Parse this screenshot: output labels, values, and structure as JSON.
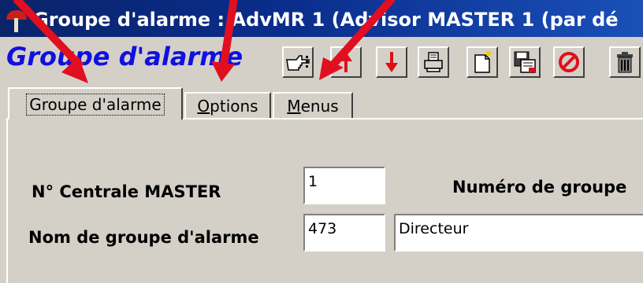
{
  "window": {
    "title": "Groupe d'alarme : AdvMR 1 (Advisor MASTER 1 (par dé",
    "icon": "alarm-light-icon"
  },
  "toolbar": {
    "title": "Groupe d'alarme",
    "buttons": [
      {
        "icon": "pointing-hand-icon"
      },
      {
        "icon": "arrow-up-icon"
      },
      {
        "icon": "arrow-down-icon"
      },
      {
        "icon": "print-icon"
      },
      {
        "icon": "new-document-icon"
      },
      {
        "icon": "save-icon"
      },
      {
        "icon": "cancel-icon"
      },
      {
        "icon": "trash-icon"
      }
    ]
  },
  "tabs": [
    {
      "label": "Groupe d'alarme",
      "active": true
    },
    {
      "label": "Options",
      "active": false
    },
    {
      "label": "Menus",
      "active": false
    }
  ],
  "form": {
    "central_label": "N° Centrale MASTER",
    "central_value": "1",
    "group_number_label": "Numéro de groupe",
    "group_name_label": "Nom de groupe d'alarme",
    "group_number_value": "473",
    "group_name_value": "Directeur"
  },
  "colors": {
    "titlebar": "#0a246a",
    "toolbar_title": "#1010e0",
    "annotation_arrow": "#e01020"
  }
}
